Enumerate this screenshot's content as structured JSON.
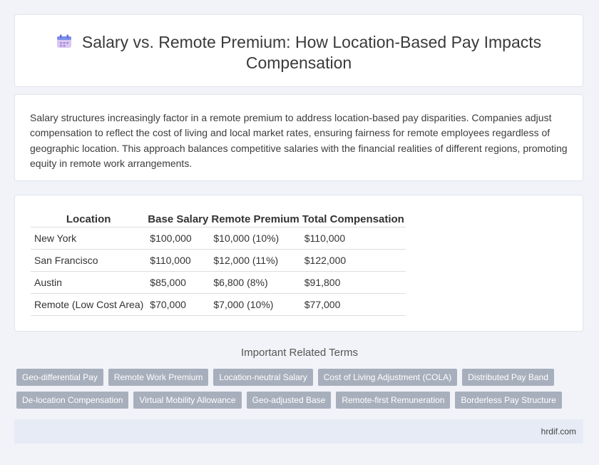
{
  "header": {
    "title": "Salary vs. Remote Premium: How Location-Based Pay Impacts Compensation",
    "icon": "calendar-icon"
  },
  "intro": {
    "text": "Salary structures increasingly factor in a remote premium to address location-based pay disparities. Companies adjust compensation to reflect the cost of living and local market rates, ensuring fairness for remote employees regardless of geographic location. This approach balances competitive salaries with the financial realities of different regions, promoting equity in remote work arrangements."
  },
  "table": {
    "headers": [
      "Location",
      "Base Salary",
      "Remote Premium",
      "Total Compensation"
    ],
    "rows": [
      [
        "New York",
        "$100,000",
        "$10,000 (10%)",
        "$110,000"
      ],
      [
        "San Francisco",
        "$110,000",
        "$12,000 (11%)",
        "$122,000"
      ],
      [
        "Austin",
        "$85,000",
        "$6,800 (8%)",
        "$91,800"
      ],
      [
        "Remote (Low Cost Area)",
        "$70,000",
        "$7,000 (10%)",
        "$77,000"
      ]
    ]
  },
  "related": {
    "title": "Important Related Terms",
    "rows": [
      [
        "Geo-differential Pay",
        "Remote Work Premium",
        "Location-neutral Salary",
        "Cost of Living Adjustment (COLA)",
        "Distributed Pay Band"
      ],
      [
        "De-location Compensation",
        "Virtual Mobility Allowance",
        "Geo-adjusted Base",
        "Remote-first Remuneration",
        "Borderless Pay Structure"
      ]
    ]
  },
  "footer": {
    "text": "hrdif.com"
  },
  "colors": {
    "tag_bg": "#a8afbc",
    "footer_bg": "#e6ebf5",
    "page_bg": "#f1f3f8"
  }
}
